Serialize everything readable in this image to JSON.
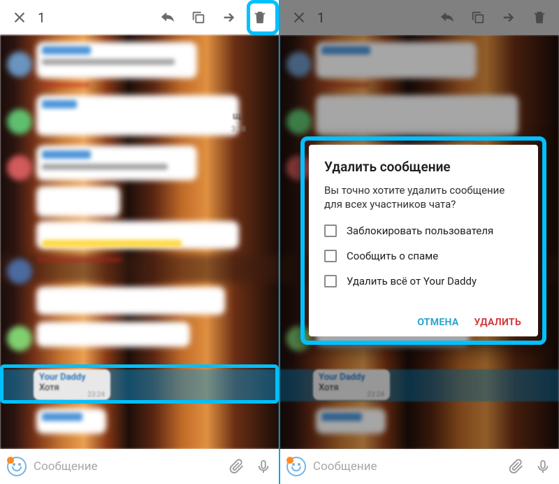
{
  "toolbar": {
    "selection_count": "1"
  },
  "selected_message": {
    "sender": "Your Daddy",
    "text": "Хотя",
    "time": "23:24"
  },
  "floating_preview": {
    "suffix": "щ…",
    "time": "3:18"
  },
  "input": {
    "placeholder_left": "Сообщение",
    "placeholder_right": "Сообщение"
  },
  "dialog": {
    "title": "Удалить сообщение",
    "body": "Вы точно хотите удалить сообщение для всех участников чата?",
    "cb_block": "Заблокировать пользователя",
    "cb_spam": "Сообщить о спаме",
    "cb_delete_all": "Удалить всё от Your Daddy",
    "cancel": "ОТМЕНА",
    "delete": "УДАЛИТЬ"
  }
}
